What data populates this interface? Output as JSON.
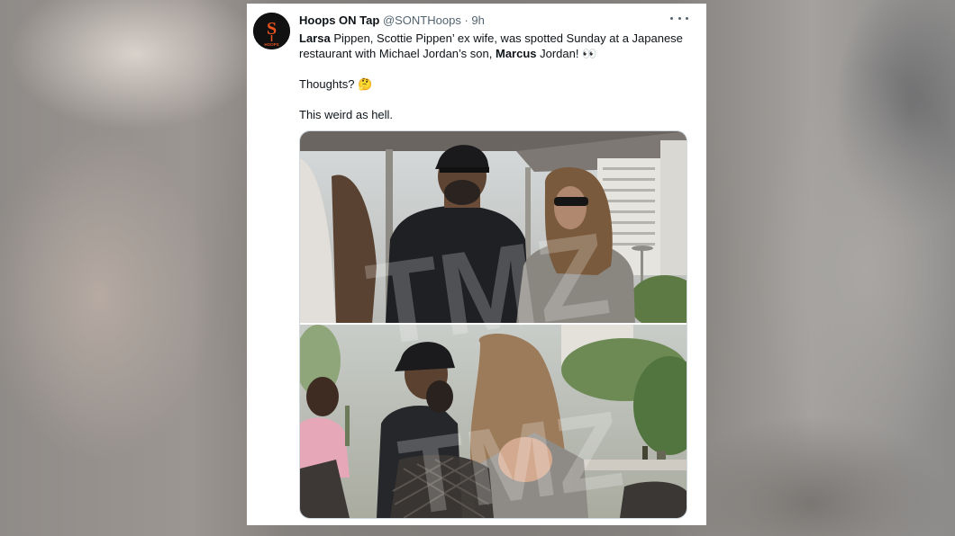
{
  "tweet": {
    "display_name": "Hoops ON Tap",
    "handle": "@SONTHoops",
    "separator": "·",
    "time": "9h",
    "line1": {
      "b1": "Larsa",
      "t1": " Pippen, Scottie Pippen’ ex wife, was spotted Sunday at a Japanese restaurant with Michael Jordan’s son, ",
      "b2": "Marcus",
      "t2": " Jordan! 👀"
    },
    "line2": "Thoughts? 🤔",
    "line3": "This weird as hell."
  },
  "avatar": {
    "initial": "S",
    "brand": "HOOPS",
    "accent": "#e8541e"
  },
  "media": {
    "watermark": "TMZ",
    "panels": 2
  },
  "icons": {
    "more": "more-horizontal-icon",
    "avatar": "hoops-logo-icon"
  },
  "colors": {
    "text": "#0f1419",
    "secondary": "#536471",
    "card": "#ffffff"
  }
}
